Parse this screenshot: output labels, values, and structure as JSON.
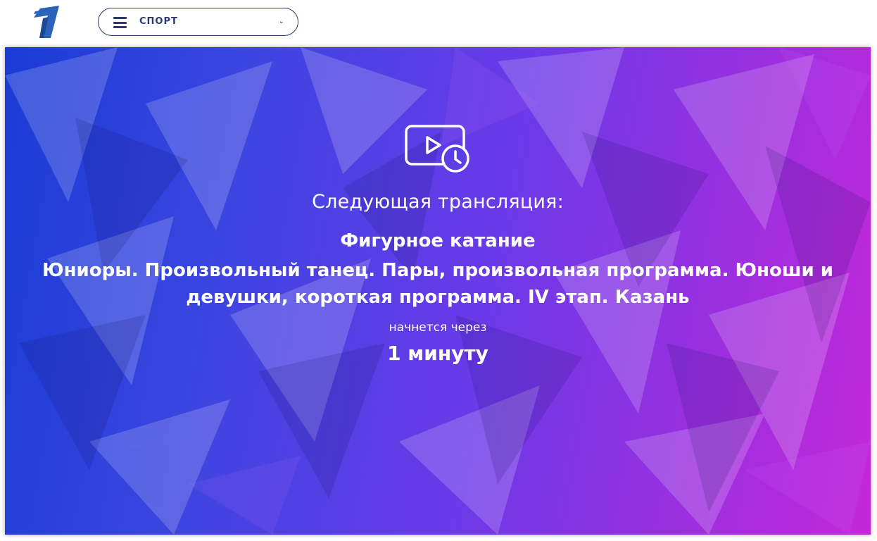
{
  "header": {
    "logo_icon": "channel-one-logo",
    "section_menu": {
      "icon": "burger-menu-icon",
      "label": "СПОРТ",
      "dropdown_icon": "chevron-down-icon"
    }
  },
  "broadcast": {
    "icon": "video-clock-icon",
    "next_label": "Следующая трансляция:",
    "title": "Фигурное катание",
    "description": "Юниоры. Произвольный танец. Пары, произвольная программа. Юноши и девушки, короткая программа. IV этап. Казань",
    "starts_in_label": "начнется через",
    "countdown": "1 минуту"
  },
  "colors": {
    "brand_dark_blue": "#2b3a6e",
    "logo_blue": "#2a63b8",
    "hero_start": "#1a3bd6",
    "hero_end": "#c428d8"
  }
}
